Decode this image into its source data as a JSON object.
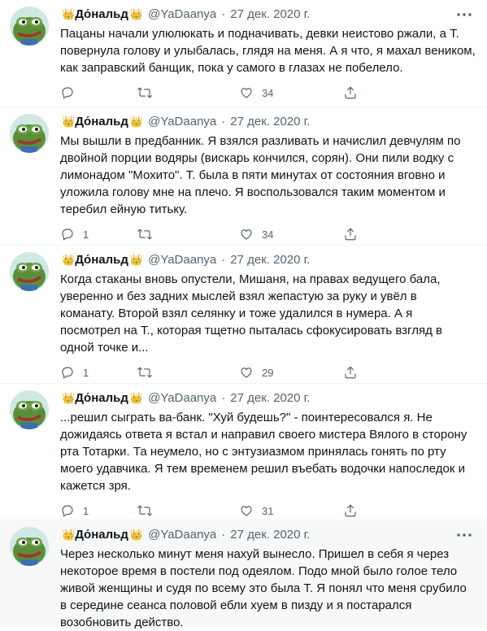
{
  "author": {
    "crown": "👑",
    "name": "До́нальд",
    "handle": "@YaDaanya",
    "separator": "·",
    "date": "27 дек. 2020 г."
  },
  "tweets": [
    {
      "text": "Пацаны начали улюлюкать и подначивать, девки неистово ржали, а Т.\nповернула голову и улыбалась, глядя на меня. А я что, я махал веником,\nкак заправский банщик, пока у самого в глазах не побелело.",
      "replies": "",
      "likes": "34"
    },
    {
      "text": "Мы вышли в предбанник. Я взялся разливать и начислил девчулям по\nдвойной порции водяры (вискарь кончился, сорян). Они пили водку с\nлимонадом \"Мохито\". Т. была в пяти минутах от состояния вговно и\nуложила голову мне на плечо. Я воспользовался таким моментом и\nтеребил ейную титьку.",
      "replies": "1",
      "likes": "34"
    },
    {
      "text": "Когда стаканы вновь опустели, Мишаня, на правах ведущего бала,\nуверенно и без задних мыслей взял жепастую за руку и увёл в\nкоманату. Второй взял селянку и тоже удалился в нумера. А я\nпосмотрел на Т., которая тщетно пыталась сфокусировать взгляд в\nодной точке и...",
      "replies": "1",
      "likes": "29"
    },
    {
      "text": "...решил сыграть ва-банк. \"Хуй будешь?\" - поинтересовался я. Не\nдожидаясь ответа я встал и направил своего мистера Вялого в сторону\nрта Тотарки. Та неумело, но с энтузиазмом принялась гонять по рту\nмоего удавчика. Я тем временем решил въебать водочки напоследок и\nкажется зря.",
      "replies": "1",
      "likes": "31"
    },
    {
      "text": "Через несколько минут меня нахуй вынесло. Пришел в себя я через\nнекоторое время в постели под одеялом. Подо мной было голое тело\nживой женщины и судя по всему это была Т. Я понял что меня срубило\nв середине сеанса половой ебли хуем в пизду и я постарался\nвозобновить действо.",
      "replies": "",
      "likes": ""
    }
  ]
}
